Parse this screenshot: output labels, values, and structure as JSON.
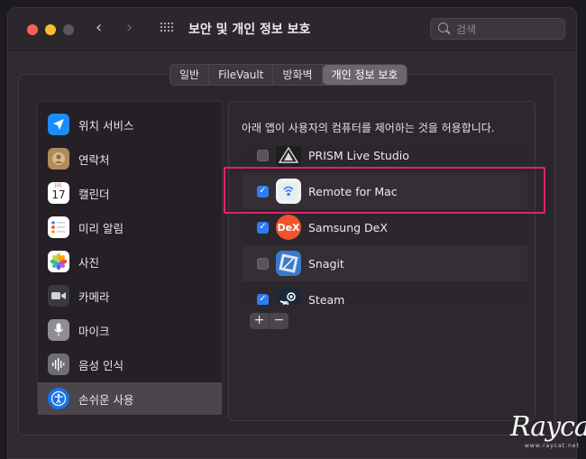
{
  "window": {
    "title": "보안 및 개인 정보 보호",
    "search_placeholder": "검색"
  },
  "tabs": [
    {
      "label": "일반",
      "active": false
    },
    {
      "label": "FileVault",
      "active": false
    },
    {
      "label": "방화벽",
      "active": false
    },
    {
      "label": "개인 정보 보호",
      "active": true
    }
  ],
  "sidebar": {
    "items": [
      {
        "label": "위치 서비스",
        "icon": "location-arrow-icon",
        "color": "#1a8cff"
      },
      {
        "label": "연락처",
        "icon": "contacts-icon",
        "color": "#b08a5b"
      },
      {
        "label": "캘린더",
        "icon": "calendar-icon",
        "color": "#ffffff",
        "month": "JUL",
        "day": "17"
      },
      {
        "label": "미리 알림",
        "icon": "reminders-icon",
        "color": "#ffffff"
      },
      {
        "label": "사진",
        "icon": "photos-icon",
        "color": "#ffffff"
      },
      {
        "label": "카메라",
        "icon": "camera-icon",
        "color": "#3a3a3c"
      },
      {
        "label": "마이크",
        "icon": "microphone-icon",
        "color": "#8e8e93"
      },
      {
        "label": "음성 인식",
        "icon": "speech-recognition-icon",
        "color": "#6e6e73"
      },
      {
        "label": "손쉬운 사용",
        "icon": "accessibility-icon",
        "color": "#1a73e8",
        "selected": true
      }
    ]
  },
  "content": {
    "header": "아래 앱이 사용자의 컴퓨터를 제어하는 것을 허용합니다.",
    "apps": [
      {
        "name": "PRISM Live Studio",
        "checked": false,
        "icon": "prism-live-studio-icon",
        "color": "#1e1e1e"
      },
      {
        "name": "Remote for Mac",
        "checked": true,
        "icon": "remote-for-mac-icon",
        "color": "#f2f2f2"
      },
      {
        "name": "Samsung DeX",
        "checked": true,
        "icon": "samsung-dex-icon",
        "color": "#f0542d",
        "mark": "DeX"
      },
      {
        "name": "Snagit",
        "checked": false,
        "icon": "snagit-icon",
        "color": "#3b7ac9"
      },
      {
        "name": "Steam",
        "checked": true,
        "icon": "steam-icon",
        "color": "#1b2838"
      }
    ],
    "add_label": "+",
    "remove_label": "−"
  },
  "watermark": {
    "text": "Raycat",
    "sub": "www.raycat.net"
  },
  "colors": {
    "accent": "#2f7bf6",
    "highlight": "#e0226a"
  }
}
